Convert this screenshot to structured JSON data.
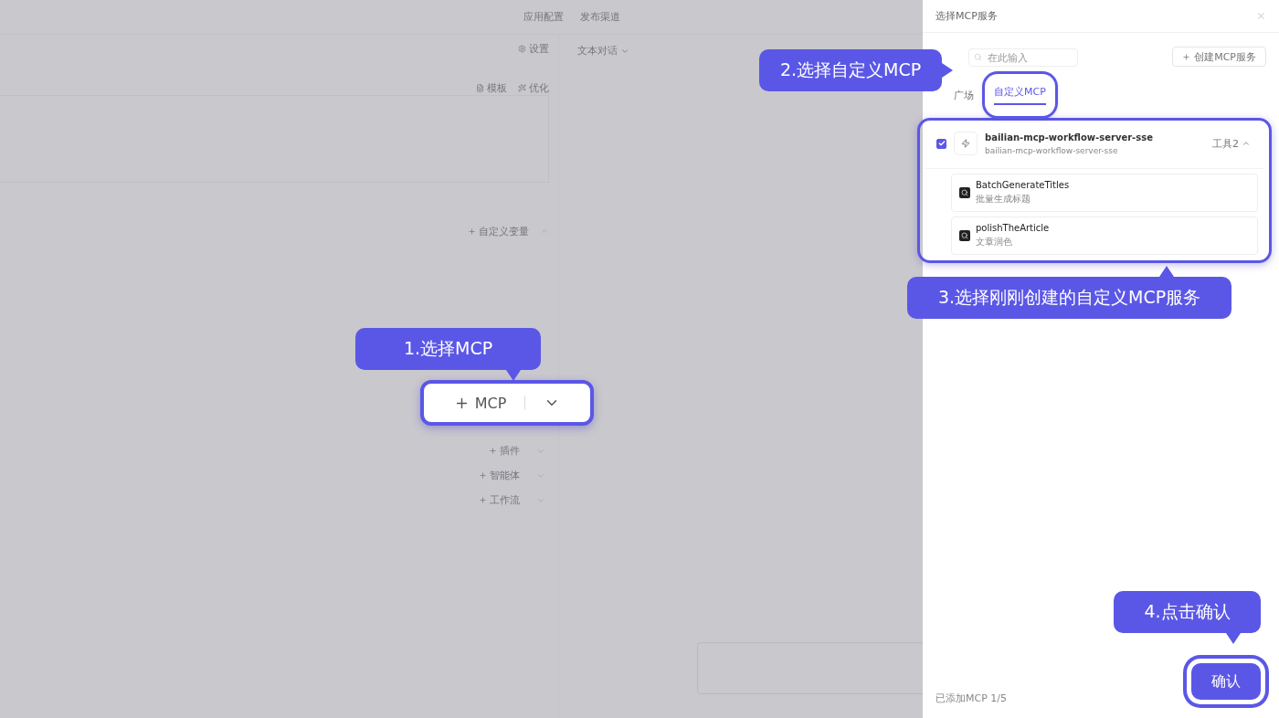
{
  "page": {
    "top_links": [
      "应用配置",
      "发布渠道"
    ],
    "mode_select": "文本对话",
    "settings_link": "设置",
    "prompt_tools": [
      "模板",
      "优化"
    ],
    "variable_button": "自定义变量",
    "mcp_button": {
      "label": "MCP"
    },
    "add_items": [
      {
        "label": "插件"
      },
      {
        "label": "智能体"
      },
      {
        "label": "工作流"
      }
    ]
  },
  "drawer": {
    "title": "选择MCP服务",
    "search": {
      "placeholder": "在此输入"
    },
    "create_button": "创建MCP服务",
    "tabs": [
      {
        "label": "广场",
        "selected": false
      },
      {
        "label": "自定义MCP",
        "selected": true
      }
    ],
    "servers": [
      {
        "name": "bailian-mcp-workflow-server-sse",
        "subtitle": "bailian-mcp-workflow-server-sse",
        "checked": true,
        "expanded": true,
        "tool_count": "工具2",
        "tools": [
          {
            "name": "BatchGenerateTitles",
            "description": "批量生成标题"
          },
          {
            "name": "polishTheArticle",
            "description": "文章润色"
          }
        ]
      }
    ],
    "footer_count": "已添加MCP 1/5",
    "confirm_button": "确认"
  },
  "callouts": [
    {
      "text": "1.选择MCP",
      "kind": "down"
    },
    {
      "text": "2.选择自定义MCP",
      "kind": "right"
    },
    {
      "text": "3.选择刚刚创建的自定义MCP服务",
      "kind": "up"
    },
    {
      "text": "4.点击确认",
      "kind": "down"
    }
  ]
}
